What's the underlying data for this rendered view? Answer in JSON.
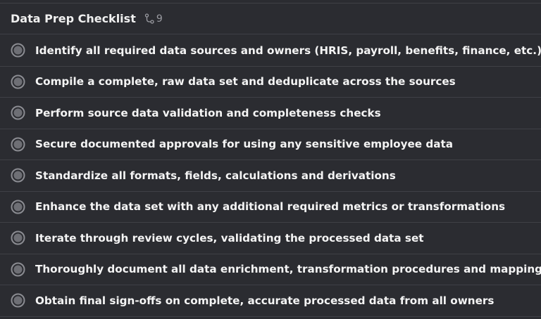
{
  "header": {
    "title": "Data Prep Checklist",
    "subtask_count": "9"
  },
  "colors": {
    "background": "#2b2c31",
    "divider": "#3f4046",
    "status_ring": "#8b8c92",
    "status_fill": "#6e6f75"
  },
  "items": [
    {
      "label": "Identify all required data sources and owners (HRIS, payroll, benefits, finance, etc.)",
      "icon": "status-circle-icon"
    },
    {
      "label": "Compile a complete, raw data set and deduplicate across the sources",
      "icon": "status-circle-icon"
    },
    {
      "label": "Perform source data validation and completeness checks",
      "icon": "status-circle-icon"
    },
    {
      "label": "Secure documented approvals for using any sensitive employee data",
      "icon": "status-circle-icon"
    },
    {
      "label": "Standardize all formats, fields, calculations and derivations",
      "icon": "status-circle-icon"
    },
    {
      "label": "Enhance the data set with any additional required metrics or transformations",
      "icon": "status-circle-icon"
    },
    {
      "label": "Iterate through review cycles, validating the processed data set",
      "icon": "status-circle-icon"
    },
    {
      "label": "Thoroughly document all data enrichment, transformation procedures and mappings",
      "icon": "status-circle-icon"
    },
    {
      "label": "Obtain final sign-offs on complete, accurate processed data from all owners",
      "icon": "status-circle-icon"
    }
  ]
}
